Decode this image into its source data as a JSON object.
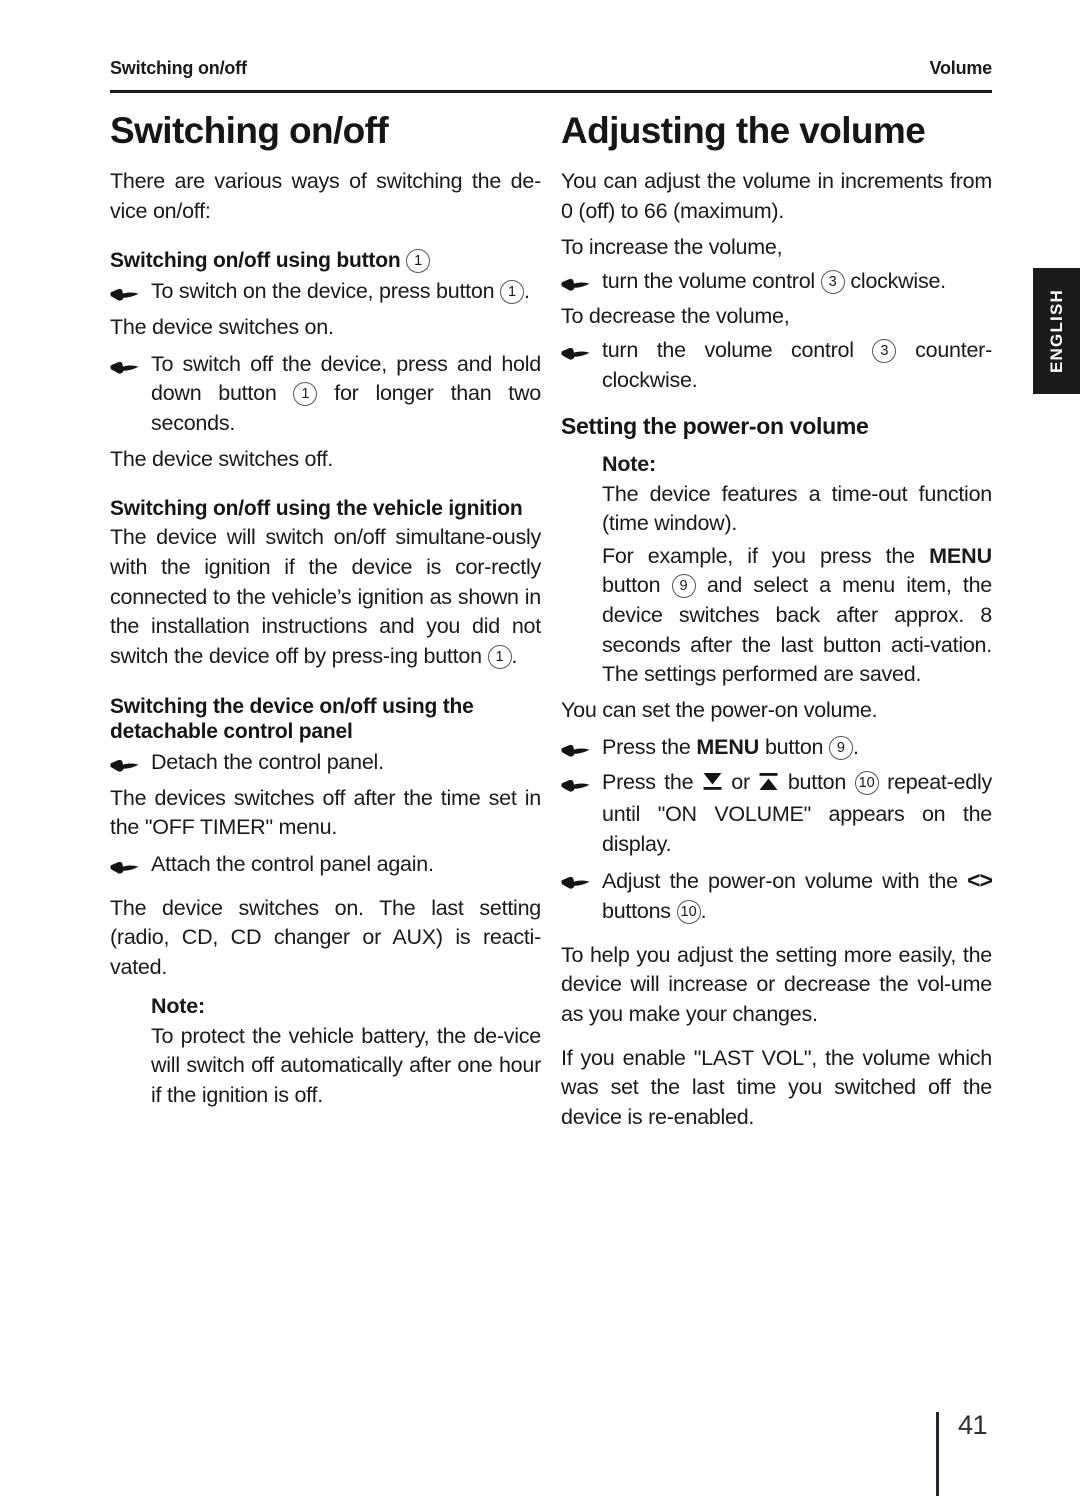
{
  "header": {
    "left": "Switching on/off",
    "right": "Volume"
  },
  "side_tab": {
    "label": "ENGLISH"
  },
  "footer": {
    "page_number": "41"
  },
  "left_column": {
    "title": "Switching on/off",
    "intro": "There are various ways of switching the de-vice on/off:",
    "heading_button": "Switching on/off using button",
    "heading_button_ref": "1",
    "bullet_switch_on_a": "To switch on the device, press button",
    "bullet_switch_on_ref": "1",
    "bullet_switch_on_b": ".",
    "result_on": "The device switches on.",
    "bullet_switch_off_a": "To switch off the device, press and hold down button",
    "bullet_switch_off_ref": "1",
    "bullet_switch_off_b": "for longer than two seconds.",
    "result_off": "The device switches off.",
    "heading_ignition": "Switching on/off using the vehicle ignition",
    "ignition_text_a": "The device will switch on/off simultane-ously with the ignition if the device is cor-rectly connected to the vehicle’s ignition as shown in the installation instructions and you did not switch the device off by press-ing button",
    "ignition_ref": "1",
    "ignition_text_b": ".",
    "heading_panel": "Switching the device on/off using the detachable control panel",
    "bullet_detach": "Detach the control panel.",
    "off_timer_text": "The devices switches off after the time set in the \"OFF TIMER\" menu.",
    "bullet_attach": "Attach the control panel again.",
    "reactivated_text": "The device switches on. The last setting (radio, CD, CD changer or AUX) is reacti-vated.",
    "note": {
      "label": "Note:",
      "text": "To protect the vehicle battery, the de-vice will switch off automatically after one hour if the ignition is off."
    }
  },
  "right_column": {
    "title": "Adjusting the volume",
    "intro": "You can adjust the volume in increments from 0 (off) to 66 (maximum).",
    "increase_lead": "To increase the volume,",
    "bullet_increase_a": "turn the volume control",
    "bullet_increase_ref": "3",
    "bullet_increase_b": "clockwise.",
    "decrease_lead": "To decrease the volume,",
    "bullet_decrease_a": "turn the volume control",
    "bullet_decrease_ref": "3",
    "bullet_decrease_b": "counter-clockwise.",
    "heading_power_on": "Setting the power-on volume",
    "note": {
      "label": "Note:",
      "text_1": "The device features a time-out function (time window).",
      "text_2a": "For example, if you press the",
      "keyword_menu": "MENU",
      "text_2b": "button",
      "ref_9": "9",
      "text_2c": "and select a menu item, the device switches back after approx. 8 seconds after the last button acti-vation. The settings performed are saved."
    },
    "can_set_text": "You can set the power-on volume.",
    "bullet_menu_a": "Press the",
    "bullet_menu_kw": "MENU",
    "bullet_menu_b": "button",
    "bullet_menu_ref": "9",
    "bullet_menu_c": ".",
    "bullet_updown_a": "Press the",
    "bullet_updown_or": "or",
    "bullet_updown_b": "button",
    "bullet_updown_ref": "10",
    "bullet_updown_c": "repeat-edly until \"ON VOLUME\" appears on the display.",
    "bullet_adjust_a": "Adjust the power-on volume with the",
    "bullet_adjust_angles": "<>",
    "bullet_adjust_b": "buttons",
    "bullet_adjust_ref": "10",
    "bullet_adjust_c": ".",
    "help_text": "To help you adjust the setting more easily, the device will increase or decrease the vol-ume as you make your changes.",
    "last_vol_text": "If you enable \"LAST VOL\", the volume which was set the last time you switched off the device is re-enabled."
  }
}
